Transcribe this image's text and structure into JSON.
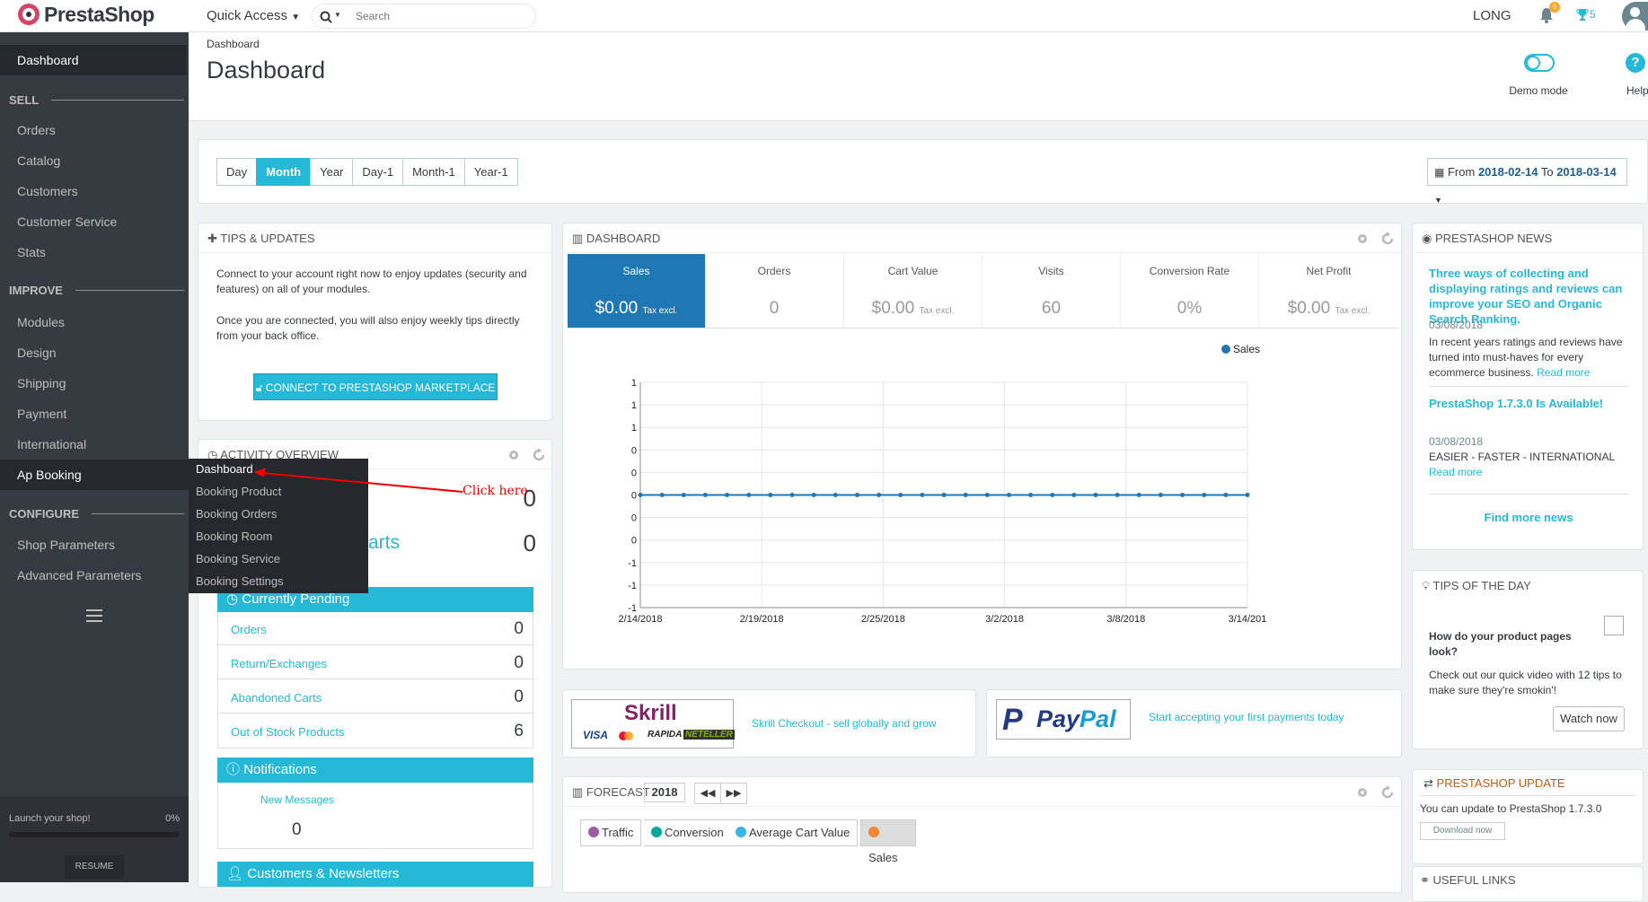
{
  "brand": {
    "name": "PrestaShop"
  },
  "topbar": {
    "quick_access": "Quick Access",
    "search_placeholder": "Search",
    "user": "LONG",
    "notif_count": "6",
    "trophy_count": "5"
  },
  "sidebar": {
    "dashboard": "Dashboard",
    "sell_label": "SELL",
    "sell": [
      "Orders",
      "Catalog",
      "Customers",
      "Customer Service",
      "Stats"
    ],
    "improve_label": "IMPROVE",
    "improve": [
      "Modules",
      "Design",
      "Shipping",
      "Payment",
      "International",
      "Ap Booking"
    ],
    "configure_label": "CONFIGURE",
    "configure": [
      "Shop Parameters",
      "Advanced Parameters"
    ],
    "launch_label": "Launch your shop!",
    "launch_pct": "0%",
    "launch_progress": 0,
    "resume": "RESUME"
  },
  "booking_menu": [
    "Dashboard",
    "Booking Product",
    "Booking Orders",
    "Booking Room",
    "Booking Service",
    "Booking Settings"
  ],
  "annotation": {
    "text": "Click here"
  },
  "header": {
    "breadcrumb": "Dashboard",
    "title": "Dashboard",
    "demo_mode": "Demo mode",
    "help": "Help"
  },
  "period": {
    "buttons": [
      "Day",
      "Month",
      "Year",
      "Day-1",
      "Month-1",
      "Year-1"
    ],
    "selected": "Month",
    "from_label": "From",
    "from": "2018-02-14",
    "to_label": "To",
    "to": "2018-03-14"
  },
  "tips": {
    "title": "TIPS & UPDATES",
    "p1": "Connect to your account right now to enjoy updates (security and features) on all of your modules.",
    "p2": "Once you are connected, you will also enjoy weekly tips directly from your back office.",
    "button": "CONNECT TO PRESTASHOP MARKETPLACE"
  },
  "activity": {
    "title": "ACTIVITY OVERVIEW",
    "val1": "0",
    "carts_partial": "arts",
    "val2": "0",
    "pending_title": "Currently Pending",
    "pending": [
      {
        "label": "Orders",
        "value": "0"
      },
      {
        "label": "Return/Exchanges",
        "value": "0"
      },
      {
        "label": "Abandoned Carts",
        "value": "0"
      },
      {
        "label": "Out of Stock Products",
        "value": "6"
      }
    ],
    "notifications_title": "Notifications",
    "new_messages": "New Messages",
    "new_messages_value": "0",
    "customers_title": "Customers & Newsletters"
  },
  "dashboard": {
    "title": "DASHBOARD",
    "kpis": [
      {
        "label": "Sales",
        "value": "$0.00",
        "unit": "Tax excl."
      },
      {
        "label": "Orders",
        "value": "0",
        "unit": ""
      },
      {
        "label": "Cart Value",
        "value": "$0.00",
        "unit": "Tax excl."
      },
      {
        "label": "Visits",
        "value": "60",
        "unit": ""
      },
      {
        "label": "Conversion Rate",
        "value": "0%",
        "unit": ""
      },
      {
        "label": "Net Profit",
        "value": "$0.00",
        "unit": "Tax excl."
      }
    ],
    "legend": "Sales",
    "y_ticks": [
      "1",
      "1",
      "1",
      "0",
      "0",
      "0",
      "0",
      "0",
      "-1",
      "-1",
      "-1"
    ],
    "x_ticks": [
      "2/14/2018",
      "2/19/2018",
      "2/25/2018",
      "3/2/2018",
      "3/8/2018",
      "3/14/201"
    ],
    "sales_points": 29,
    "sales_value": 0,
    "accent": "#1f78b4"
  },
  "skrill": {
    "logo": "Skrill",
    "cards": "VISA",
    "rapida": "RAPIDA",
    "neteller": "NETELLER",
    "text": "Skrill Checkout - sell globally and grow"
  },
  "paypal": {
    "logo_a": "Pay",
    "logo_b": "Pal",
    "text": "Start accepting your first payments today"
  },
  "forecast": {
    "title": "FORECAST",
    "year": "2018",
    "tags": [
      {
        "label": "Traffic",
        "color": "#9e5ba1"
      },
      {
        "label": "Conversion",
        "color": "#00a89c"
      },
      {
        "label": "Average Cart Value",
        "color": "#3ab5e6"
      },
      {
        "label": "Sales",
        "color": "#f38733"
      }
    ]
  },
  "news": {
    "title": "PRESTASHOP NEWS",
    "items": [
      {
        "title": "Three ways of collecting and displaying ratings and reviews can improve your SEO and Organic Search Ranking.",
        "date": "03/08/2018",
        "body": "In recent years ratings and reviews have turned into must-haves for every ecommerce business.",
        "more": "Read more"
      },
      {
        "title": "PrestaShop 1.7.3.0 Is Available!",
        "date": "03/08/2018",
        "body": "EASIER - FASTER - INTERNATIONAL",
        "more": "Read more"
      }
    ],
    "find_more": "Find more news"
  },
  "tip_day": {
    "title": "TIPS OF THE DAY",
    "question": "How do your product pages look?",
    "body": "Check out our quick video with 12 tips to make sure they're smokin'!",
    "button": "Watch now"
  },
  "update": {
    "title": "PRESTASHOP UPDATE",
    "text": "You can update to PrestaShop 1.7.3.0",
    "button": "Download now"
  },
  "useful": {
    "title": "USEFUL LINKS"
  }
}
